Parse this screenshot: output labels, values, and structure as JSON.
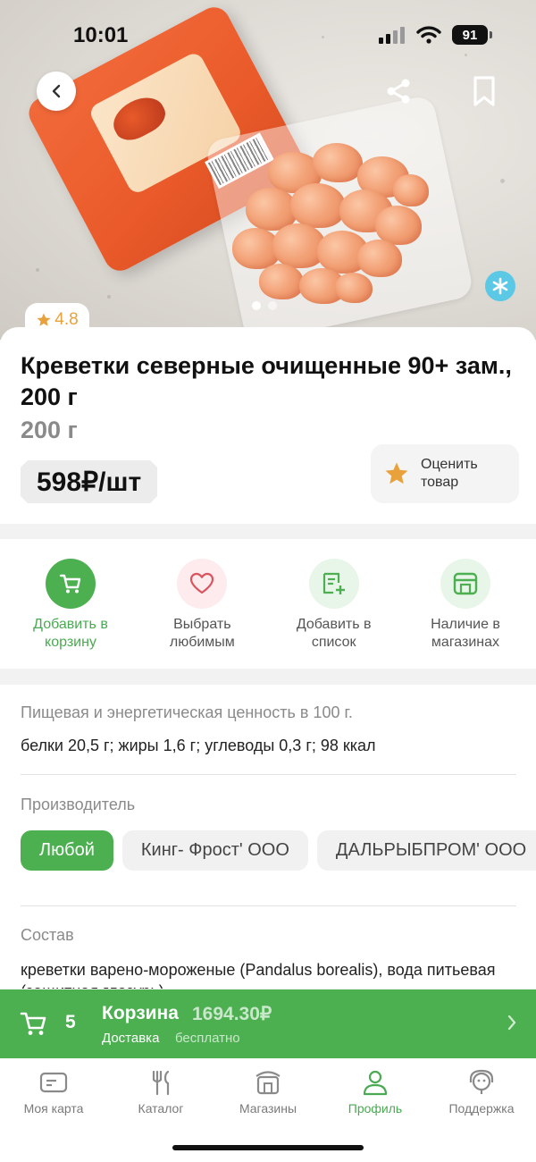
{
  "status_bar": {
    "time": "10:01",
    "battery": "91"
  },
  "product": {
    "rating": "4.8",
    "title": "Креветки северные очищенные 90+ зам., 200 г",
    "weight": "200 г",
    "price": "598₽/шт",
    "rate_label": "Оценить товар"
  },
  "actions": {
    "add_to_cart": "Добавить в корзину",
    "favorite": "Выбрать любимым",
    "add_to_list": "Добавить в список",
    "availability": "Наличие в магазинах"
  },
  "details": {
    "nutrition_label": "Пищевая и энергетическая ценность в 100 г.",
    "nutrition_value": "белки 20,5 г; жиры 1,6 г; углеводы 0,3 г; 98 ккал",
    "manufacturer_label": "Производитель",
    "manufacturers": [
      "Любой",
      "Кинг- Фрост' ООО",
      "ДАЛЬРЫБПРОМ' ООО"
    ],
    "composition_label": "Состав",
    "composition_value": "креветки варено-мороженые (Pandalus borealis), вода питьевая (защитная глазурь)"
  },
  "cart": {
    "count": "5",
    "title": "Корзина",
    "total": "1694.30₽",
    "delivery_label": "Доставка",
    "delivery_value": "бесплатно"
  },
  "tabs": [
    "Моя карта",
    "Каталог",
    "Магазины",
    "Профиль",
    "Поддержка"
  ],
  "colors": {
    "accent": "#4caf50",
    "star": "#e9a13b",
    "snowflake": "#5bc8e6"
  }
}
